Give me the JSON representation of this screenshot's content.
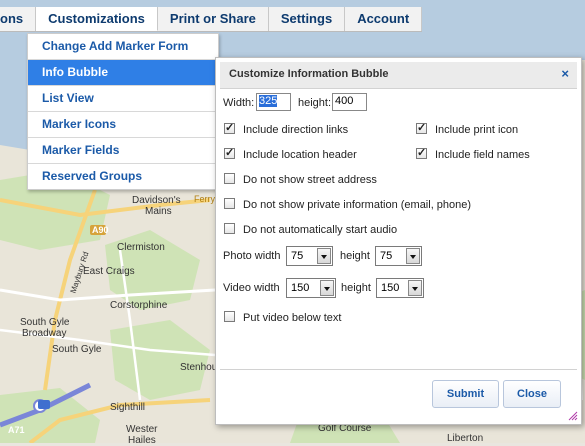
{
  "nav": {
    "items": [
      "ons",
      "Customizations",
      "Print or Share",
      "Settings",
      "Account"
    ],
    "active_index": 1
  },
  "dropdown": {
    "items": [
      "Change Add Marker Form",
      "Info Bubble",
      "List View",
      "Marker Icons",
      "Marker Fields",
      "Reserved Groups"
    ],
    "selected_index": 1
  },
  "dialog": {
    "title": "Customize Information Bubble",
    "close_icon": "×",
    "width_label": "Width:",
    "width_value": "325",
    "height_label": "height:",
    "height_value": "400",
    "checkboxes": [
      {
        "label": "Include direction links",
        "checked": true
      },
      {
        "label": "Include print icon",
        "checked": true
      },
      {
        "label": "Include location header",
        "checked": true
      },
      {
        "label": "Include field names",
        "checked": true
      },
      {
        "label": "Do not show street address",
        "checked": false
      },
      {
        "label": "Do not show private information (email, phone)",
        "checked": false
      },
      {
        "label": "Do not automatically start audio",
        "checked": false
      },
      {
        "label": "Put video below text",
        "checked": false
      }
    ],
    "photo_width_label": "Photo width",
    "photo_width": "75",
    "photo_height_label": "height",
    "photo_height": "75",
    "video_width_label": "Video width",
    "video_width": "150",
    "video_height_label": "height",
    "video_height": "150",
    "submit_label": "Submit",
    "close_label": "Close"
  },
  "map": {
    "labels": [
      "Davidson's",
      "Mains",
      "Ferry",
      "A90",
      "Clermiston",
      "East Craigs",
      "Corstorphine",
      "South Gyle",
      "Broadway",
      "South Gyle",
      "Stenhou",
      "Sighthill",
      "Wester",
      "Hailes",
      "Golf Course",
      "Liberton",
      "Maybury Rd",
      "A71"
    ]
  },
  "colors": {
    "accent": "#1b5aa8",
    "selected": "#2f7fe6"
  }
}
